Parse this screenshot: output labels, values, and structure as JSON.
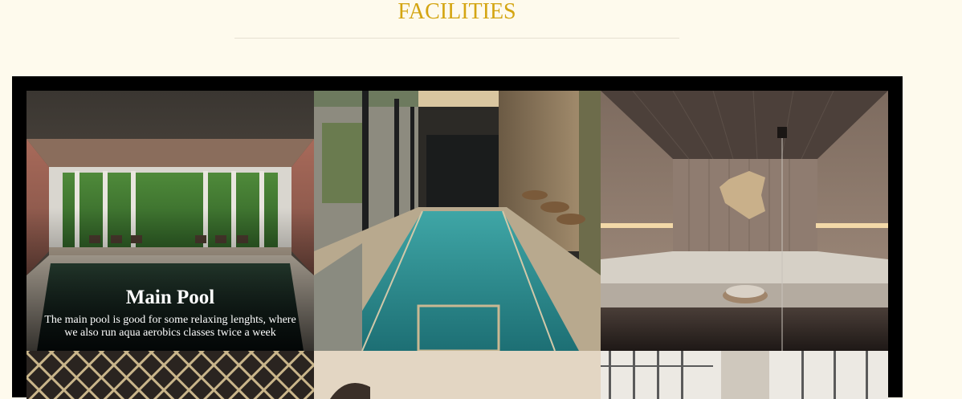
{
  "section": {
    "title": "FACILITIES"
  },
  "facilities": [
    {
      "name": "Main Pool",
      "description": "The main pool is good for some relaxing lenghts, where we also run aqua aerobics classes twice a week"
    }
  ],
  "colors": {
    "background": "#fefaed",
    "title_gold": "#d4a512",
    "frame": "#000000"
  }
}
